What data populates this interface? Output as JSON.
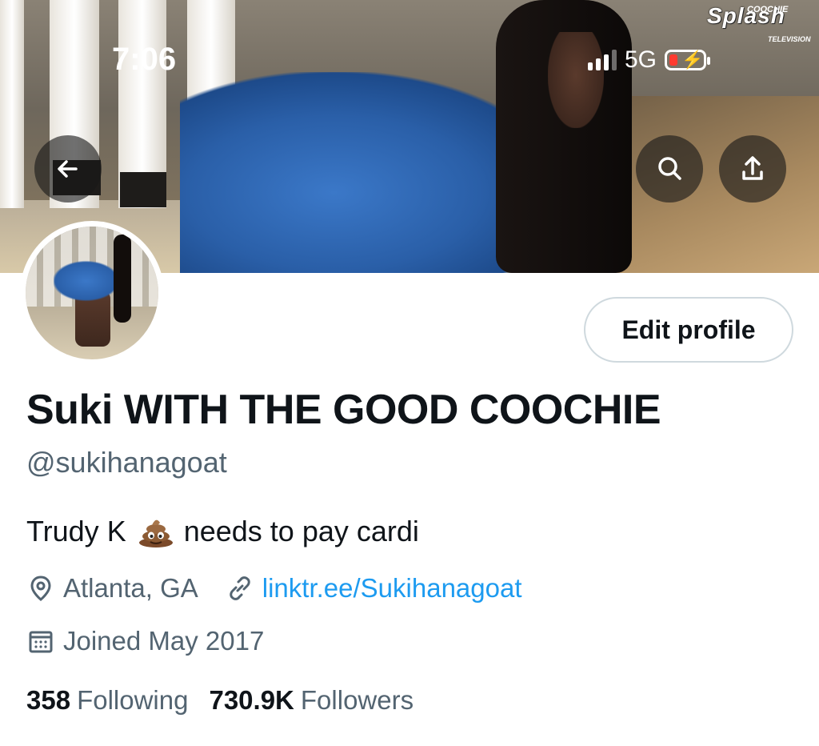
{
  "status_bar": {
    "time": "7:06",
    "network": "5G"
  },
  "banner": {
    "watermark_top": "COOCHIE",
    "watermark_main": "Splash",
    "watermark_sub": "TELEVISION"
  },
  "profile": {
    "edit_label": "Edit profile",
    "display_name": "Suki WITH THE GOOD COOCHIE",
    "handle": "@sukihanagoat",
    "bio_before": "Trudy K",
    "bio_emoji": "pile-of-poo-icon",
    "bio_after": "needs to pay cardi",
    "location": "Atlanta, GA",
    "link": "linktr.ee/Sukihanagoat",
    "joined": "Joined May 2017",
    "following_count": "358",
    "following_label": "Following",
    "followers_count": "730.9K",
    "followers_label": "Followers"
  },
  "colors": {
    "text_primary": "#0f1419",
    "text_secondary": "#536471",
    "link": "#1d9bf0",
    "border": "#cfd9de",
    "battery_low": "#ff3b30"
  }
}
